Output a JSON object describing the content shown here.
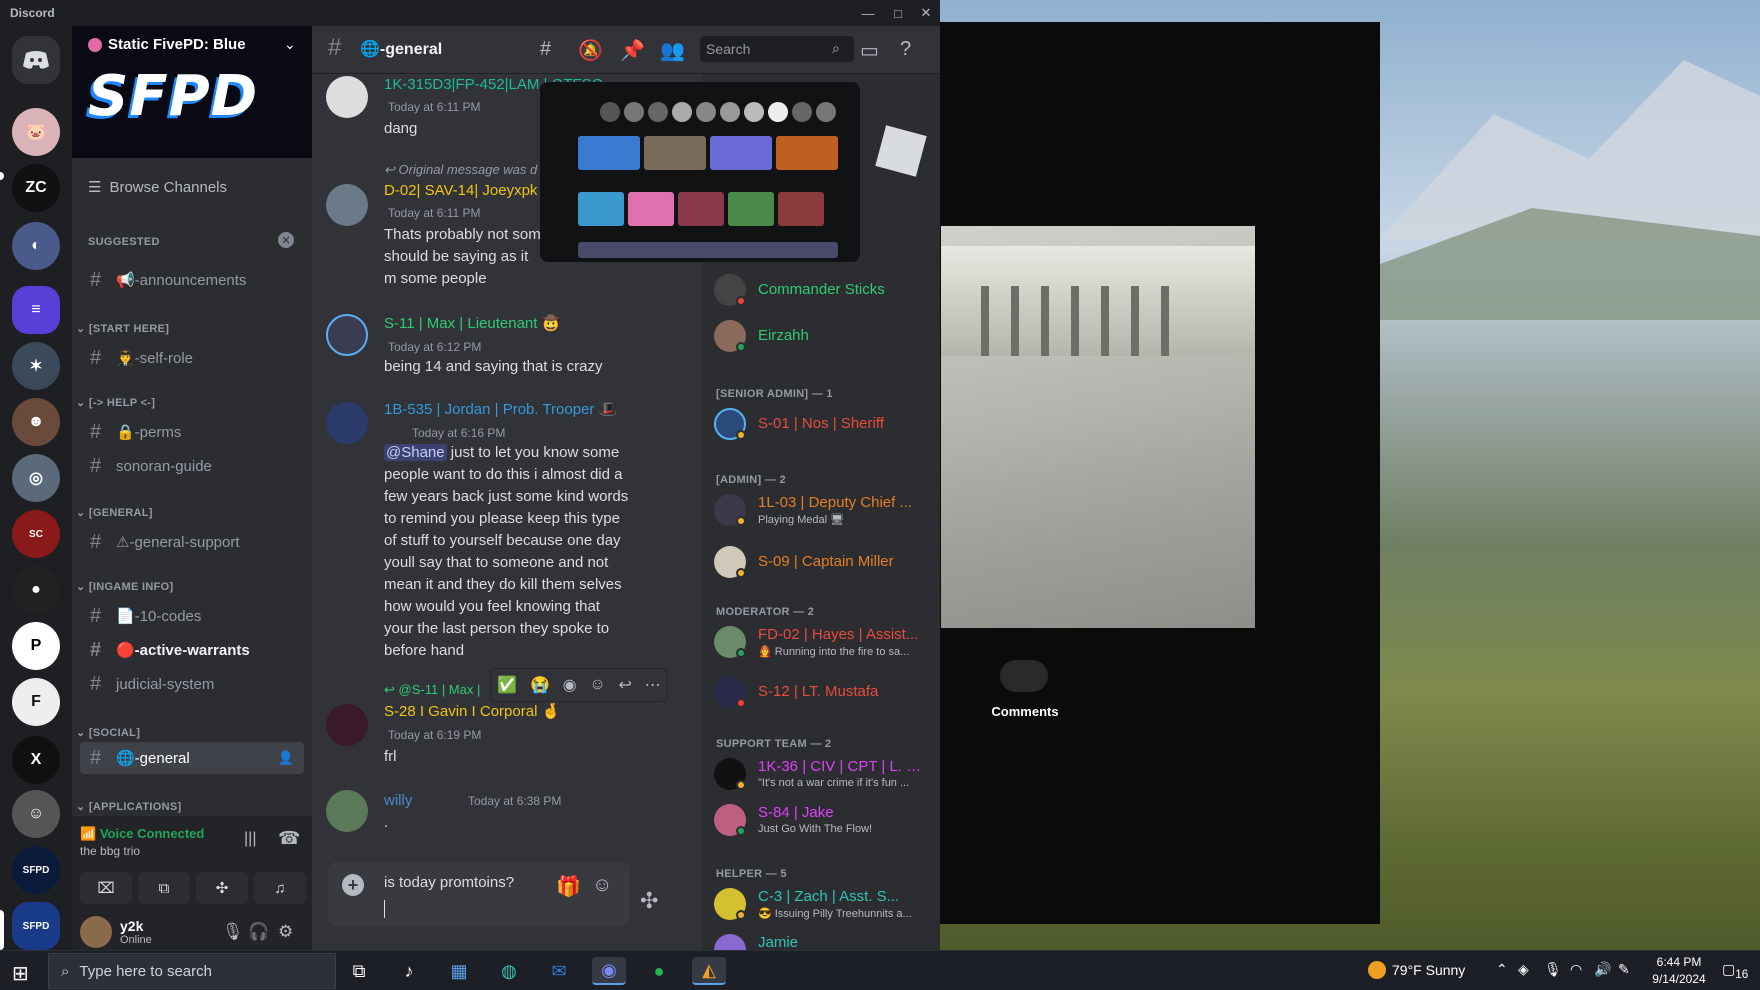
{
  "window": {
    "app_name": "Discord",
    "minimize": "—",
    "maximize": "□",
    "close": "✕"
  },
  "server": {
    "name": "Static FivePD: Blue",
    "banner_logo": "SFPD"
  },
  "sidebar": {
    "browse": "Browse Channels",
    "categories": {
      "suggested": "SUGGESTED",
      "start_here": "[START HERE]",
      "help": "[-> HELP <-]",
      "general": "[GENERAL]",
      "ingame_info": "[INGAME INFO]",
      "social": "[SOCIAL]",
      "applications": "[APPLICATIONS]"
    },
    "channels": {
      "announcements": "📢-announcements",
      "self_role": "👨‍✈️-self-role",
      "perms": "🔒-perms",
      "sonoran_guide": "sonoran-guide",
      "general_support": "⚠-general-support",
      "ten_codes": "📄-10-codes",
      "active_warrants": "🔴-active-warrants",
      "judicial_system": "judicial-system",
      "general": "🌐-general"
    }
  },
  "voice": {
    "status": "Voice Connected",
    "channel": "the bbg trio"
  },
  "user": {
    "name": "y2k",
    "status": "Online"
  },
  "chat": {
    "channel": "🌐-general",
    "search_placeholder": "Search",
    "messages": [
      {
        "author": "1K-315D3|FP-452|LAM | OTFSO",
        "time": "Today at 6:11 PM",
        "text": "dang"
      },
      {
        "reply": "Original message was d",
        "author": "D-02| SAV-14| Joeyxpk",
        "time": "Today at 6:11 PM",
        "text": "Thats probably not som should be saying as it m some people"
      },
      {
        "author": "S-11 | Max | Lieutenant 🤠",
        "time": "Today at 6:12 PM",
        "text": "being 14 and saying that is crazy"
      },
      {
        "author": "1B-535 | Jordan | Prob. Trooper 🎩",
        "time": "Today at 6:16 PM",
        "mention": "@Shane",
        "text": " just to let you know some people want to do this i almost did a few years back just some kind words to remind you please keep this type of stuff to yourself because one day youll say that to someone and not mean it and they do kill them selves how would you feel knowing that your the last person they spoke to before hand"
      },
      {
        "reply": "@S-11 | Max |",
        "author": "S-28 I Gavin I Corporal 🤞",
        "time": "Today at 6:19 PM",
        "text": "frl"
      },
      {
        "author": "willy",
        "time": "Today at 6:38 PM",
        "text": "."
      }
    ],
    "composer_text": "is today promtoins?"
  },
  "members": {
    "groups": {
      "senior_admin": "[SENIOR ADMIN] — 1",
      "admin": "[ADMIN] — 2",
      "moderator": "MODERATOR — 2",
      "support_team": "SUPPORT TEAM — 2",
      "helper": "HELPER — 5"
    },
    "list": [
      {
        "name": "Commander Sticks",
        "status": ""
      },
      {
        "name": "Eirzahh",
        "status": ""
      },
      {
        "name": "S-01 | Nos | Sheriff",
        "status": ""
      },
      {
        "name": "1L-03 | Deputy Chief ...",
        "status": "Playing Medal 🖥"
      },
      {
        "name": "S-09 | Captain Miller",
        "status": ""
      },
      {
        "name": "FD-02 | Hayes | Assist...",
        "status": "🧑‍🚒 Running into the fire to sa..."
      },
      {
        "name": "S-12 | LT. Mustafa",
        "status": ""
      },
      {
        "name": "1K-36 | CIV | CPT | L. K...",
        "status": "\"It's not a war crime if it's fun ..."
      },
      {
        "name": "S-84 | Jake",
        "status": "Just Go With The Flow!"
      },
      {
        "name": "C-3 | Zach | Asst. S...",
        "status": "😎 Issuing Pilly Treehunnits a..."
      },
      {
        "name": "Jamie",
        "status": ""
      }
    ]
  },
  "overlay": {
    "comments": "Comments"
  },
  "taskbar": {
    "search_placeholder": "Type here to search",
    "weather": "79°F  Sunny",
    "time": "6:44 PM",
    "date": "9/14/2024",
    "notifications": "16"
  },
  "colors": {
    "accent": "#5865f2",
    "online": "#23a55a",
    "dnd": "#f23f43",
    "idle": "#f0b232"
  }
}
